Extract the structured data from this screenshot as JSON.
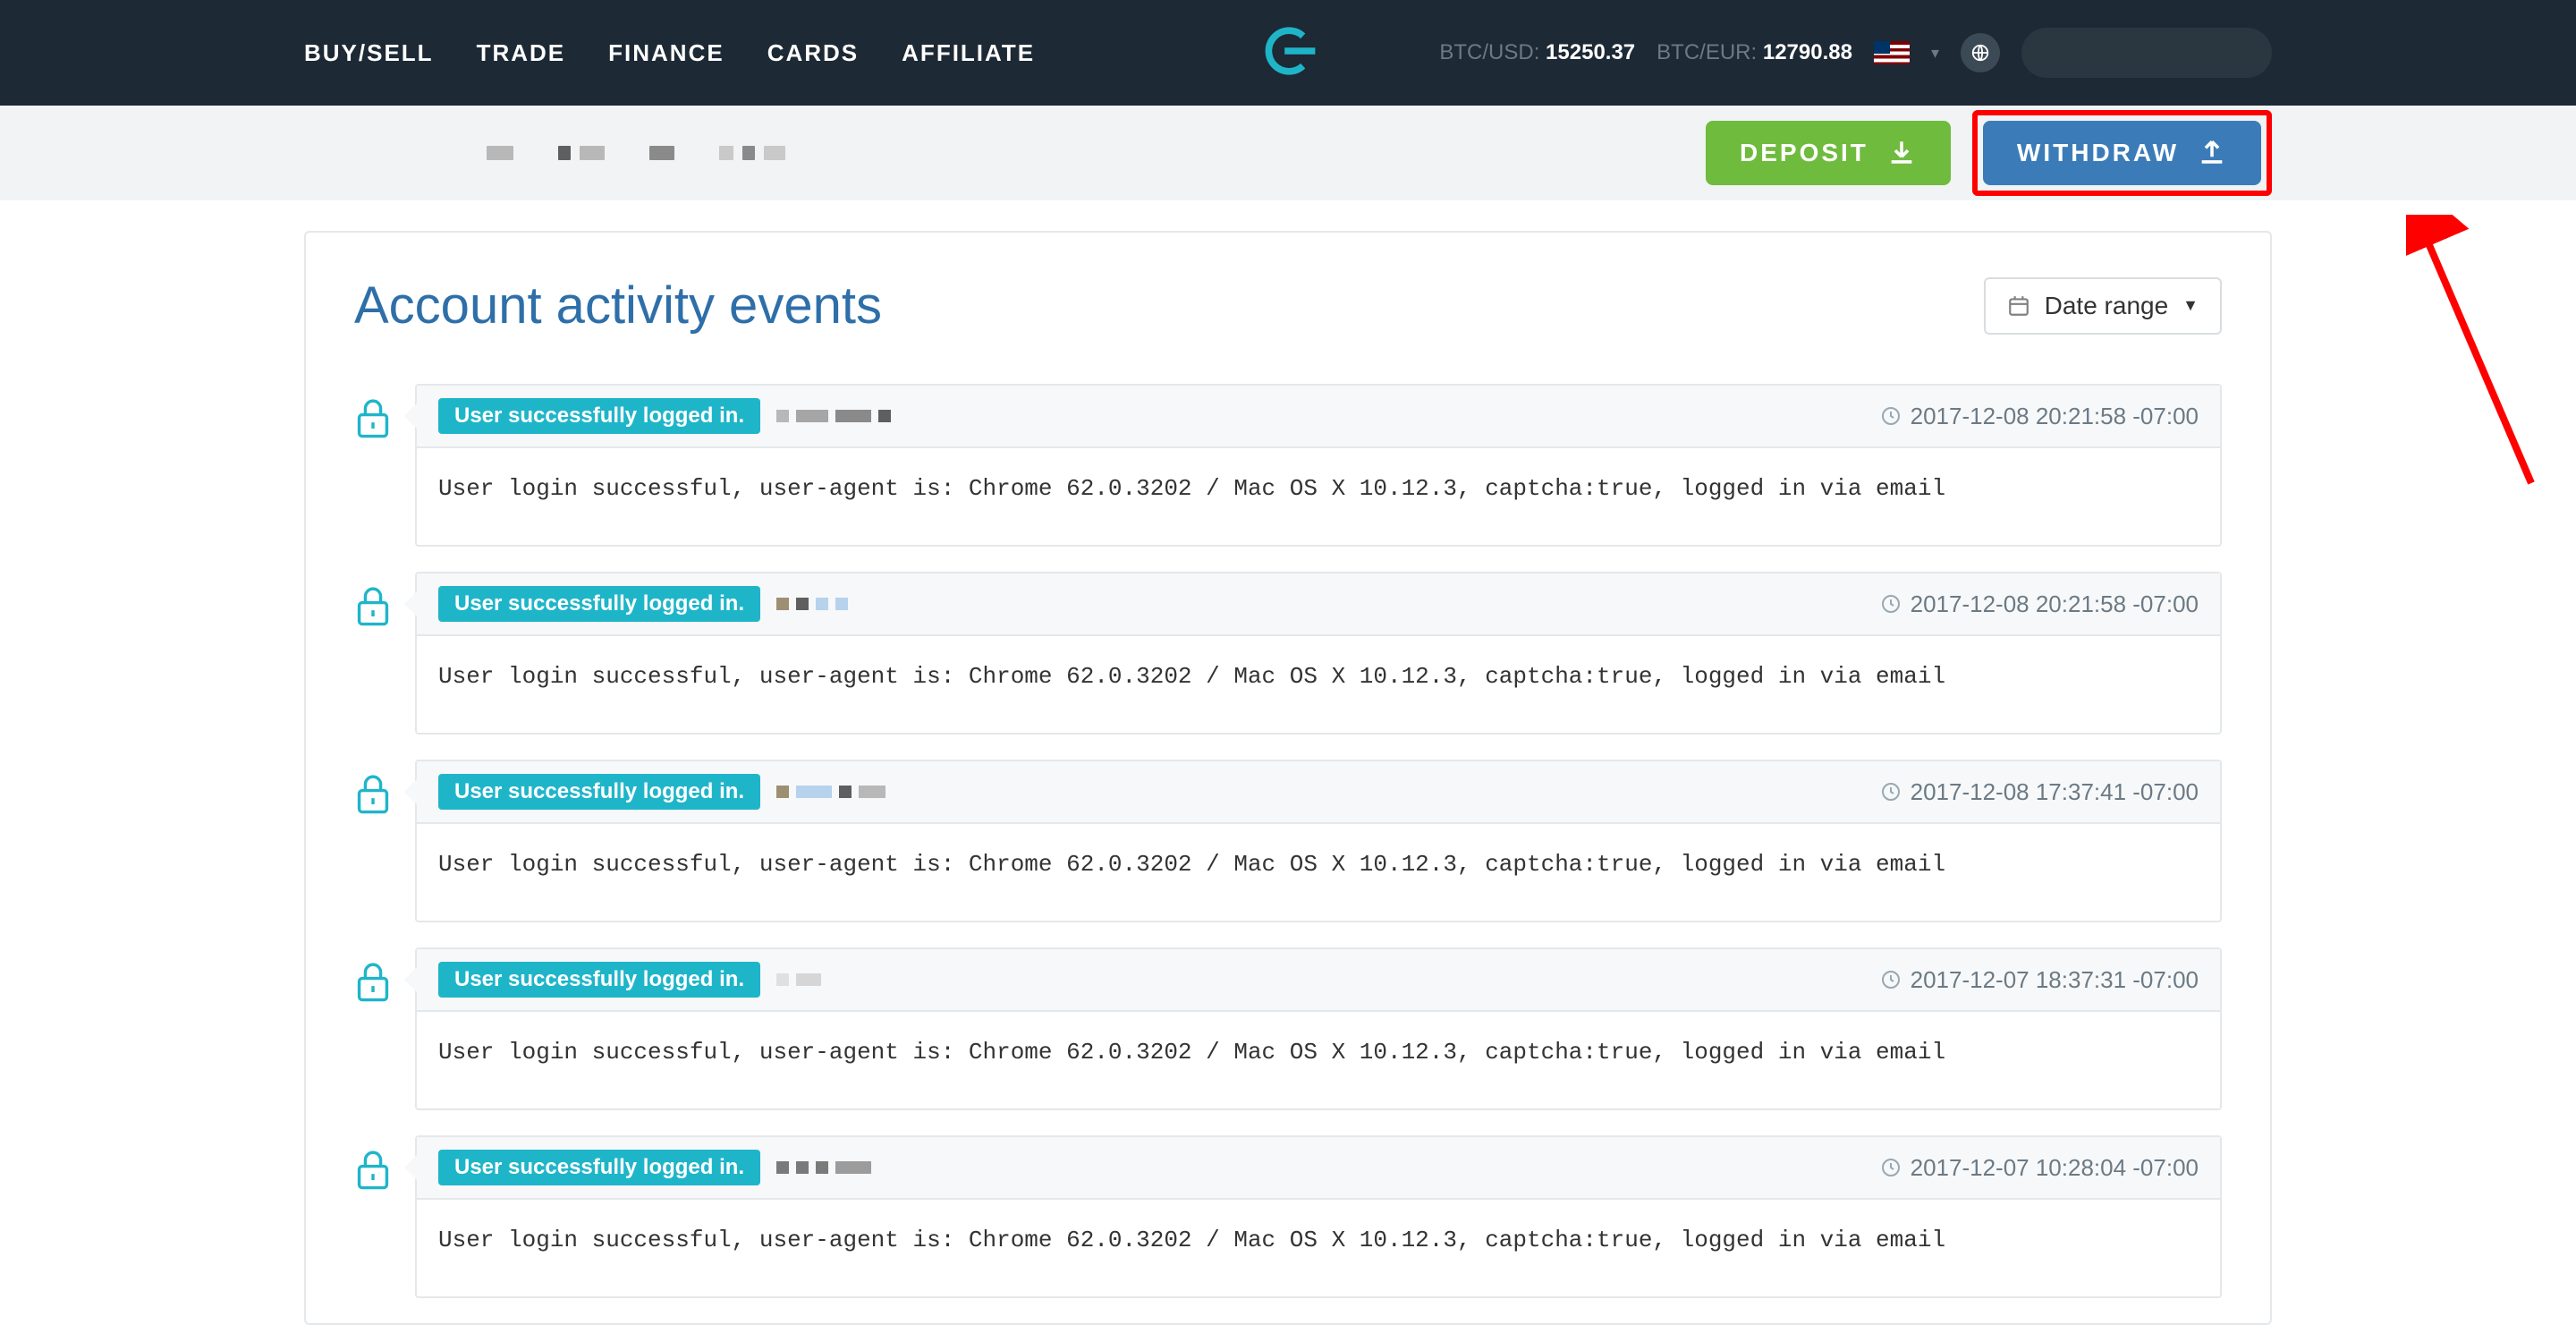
{
  "nav": {
    "links": [
      "BUY/SELL",
      "TRADE",
      "FINANCE",
      "CARDS",
      "AFFILIATE"
    ],
    "tickers": [
      {
        "label": "BTC/USD:",
        "value": "15250.37"
      },
      {
        "label": "BTC/EUR:",
        "value": "12790.88"
      }
    ]
  },
  "actions": {
    "deposit": "DEPOSIT",
    "withdraw": "WITHDRAW"
  },
  "page": {
    "title": "Account activity events",
    "date_range_label": "Date range"
  },
  "events": [
    {
      "badge": "User successfully logged in.",
      "timestamp": "2017-12-08 20:21:58 -07:00",
      "body": "User login successful, user-agent is: Chrome 62.0.3202 / Mac OS X 10.12.3, captcha:true, logged in via email",
      "redacts": [
        {
          "w": 14,
          "c": "#b8b8b8"
        },
        {
          "w": 36,
          "c": "#a6a6a6"
        },
        {
          "w": 40,
          "c": "#8a8a8a"
        },
        {
          "w": 14,
          "c": "#5f5f5f"
        }
      ]
    },
    {
      "badge": "User successfully logged in.",
      "timestamp": "2017-12-08 20:21:58 -07:00",
      "body": "User login successful, user-agent is: Chrome 62.0.3202 / Mac OS X 10.12.3, captcha:true, logged in via email",
      "redacts": [
        {
          "w": 14,
          "c": "#9e8f73"
        },
        {
          "w": 14,
          "c": "#5f5f5f"
        },
        {
          "w": 14,
          "c": "#b7d2ec"
        },
        {
          "w": 14,
          "c": "#b7d2ec"
        }
      ]
    },
    {
      "badge": "User successfully logged in.",
      "timestamp": "2017-12-08 17:37:41 -07:00",
      "body": "User login successful, user-agent is: Chrome 62.0.3202 / Mac OS X 10.12.3, captcha:true, logged in via email",
      "redacts": [
        {
          "w": 14,
          "c": "#9e8f73"
        },
        {
          "w": 40,
          "c": "#b7d2ec"
        },
        {
          "w": 14,
          "c": "#5f5f5f"
        },
        {
          "w": 30,
          "c": "#b8b8b8"
        }
      ]
    },
    {
      "badge": "User successfully logged in.",
      "timestamp": "2017-12-07 18:37:31 -07:00",
      "body": "User login successful, user-agent is: Chrome 62.0.3202 / Mac OS X 10.12.3, captcha:true, logged in via email",
      "redacts": [
        {
          "w": 14,
          "c": "#e0e0e0"
        },
        {
          "w": 28,
          "c": "#d6d6d6"
        }
      ]
    },
    {
      "badge": "User successfully logged in.",
      "timestamp": "2017-12-07 10:28:04 -07:00",
      "body": "User login successful, user-agent is: Chrome 62.0.3202 / Mac OS X 10.12.3, captcha:true, logged in via email",
      "redacts": [
        {
          "w": 14,
          "c": "#7a7a7a"
        },
        {
          "w": 14,
          "c": "#7a7a7a"
        },
        {
          "w": 14,
          "c": "#7a7a7a"
        },
        {
          "w": 40,
          "c": "#9c9c9c"
        }
      ]
    }
  ]
}
